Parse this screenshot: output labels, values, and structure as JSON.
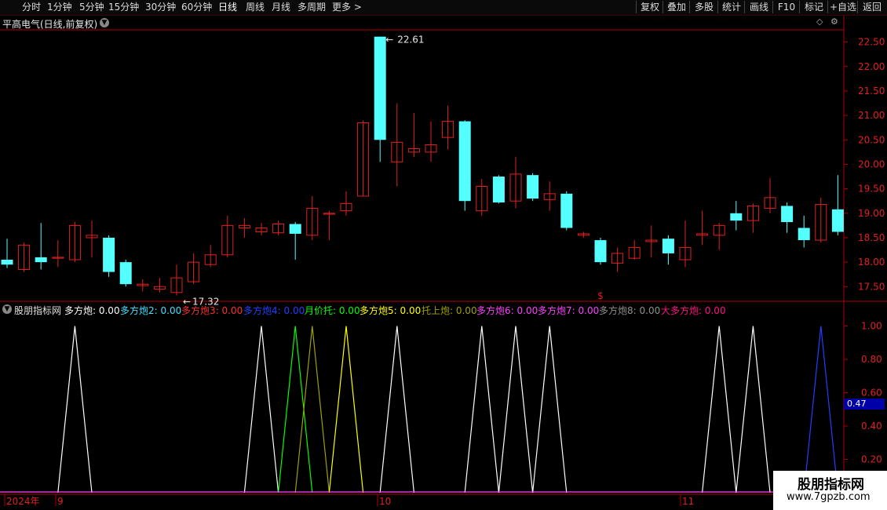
{
  "toolbar": {
    "tabs": [
      "分时",
      "1分钟",
      "5分钟",
      "15分钟",
      "30分钟",
      "60分钟",
      "日线",
      "周线",
      "月线",
      "多周期",
      "更多"
    ],
    "active_tab": "日线",
    "more_arrow": ">",
    "right_buttons": [
      "复权",
      "叠加",
      "多股",
      "统计",
      "画线",
      "F10",
      "标记",
      "+自选",
      "返回"
    ]
  },
  "main_chart": {
    "title": "平高电气(日线,前复权)",
    "dropdown_icon": "chevron-down-icon",
    "high_label": "22.61",
    "low_label": "17.32",
    "signal_mark": "$"
  },
  "indicator": {
    "name": "股朋指标网",
    "items": [
      {
        "label": "多方炮:",
        "value": "0.00",
        "color": "#ffffff"
      },
      {
        "label": "多方炮2:",
        "value": "0.00",
        "color": "#40e0ff"
      },
      {
        "label": "多方炮3:",
        "value": "0.00",
        "color": "#ff3030"
      },
      {
        "label": "多方炮4:",
        "value": "0.00",
        "color": "#2040ff"
      },
      {
        "label": "月价托:",
        "value": "0.00",
        "color": "#00ff00"
      },
      {
        "label": "多方炮5:",
        "value": "0.00",
        "color": "#ffff00"
      },
      {
        "label": "托上炮:",
        "value": "0.00",
        "color": "#a0a000"
      },
      {
        "label": "多方炮6:",
        "value": "0.00",
        "color": "#ff40ff"
      },
      {
        "label": "多方炮7:",
        "value": "0.00",
        "color": "#ff40ff"
      },
      {
        "label": "多方炮8:",
        "value": "0.00",
        "color": "#909090"
      },
      {
        "label": "大多方炮:",
        "value": "0.00",
        "color": "#ff1080"
      }
    ],
    "current_value": "0.47"
  },
  "watermark": {
    "line1": "股朋指标网",
    "line2": "www.7gpzb.com"
  },
  "chart_data": [
    {
      "type": "candlestick",
      "title": "平高电气(日线,前复权)",
      "y_ticks": [
        "22.50",
        "22.00",
        "21.50",
        "21.00",
        "20.50",
        "20.00",
        "19.50",
        "19.00",
        "18.50",
        "18.00",
        "17.50"
      ],
      "ylim": [
        17.2,
        22.75
      ],
      "x_labels": [
        "2024年",
        "9",
        "10",
        "11"
      ],
      "candles": [
        {
          "o": 18.05,
          "c": 17.95,
          "h": 18.48,
          "l": 17.88
        },
        {
          "o": 17.85,
          "c": 18.35,
          "h": 18.4,
          "l": 17.8
        },
        {
          "o": 18.1,
          "c": 18.0,
          "h": 18.8,
          "l": 17.85
        },
        {
          "o": 18.08,
          "c": 18.1,
          "h": 18.45,
          "l": 17.9
        },
        {
          "o": 18.05,
          "c": 18.75,
          "h": 18.82,
          "l": 18.0
        },
        {
          "o": 18.5,
          "c": 18.55,
          "h": 18.85,
          "l": 18.1
        },
        {
          "o": 18.5,
          "c": 17.8,
          "h": 18.55,
          "l": 17.7
        },
        {
          "o": 18.0,
          "c": 17.55,
          "h": 18.05,
          "l": 17.5
        },
        {
          "o": 17.52,
          "c": 17.55,
          "h": 17.65,
          "l": 17.4
        },
        {
          "o": 17.45,
          "c": 17.5,
          "h": 17.68,
          "l": 17.38
        },
        {
          "o": 17.38,
          "c": 17.68,
          "h": 17.95,
          "l": 17.32
        },
        {
          "o": 17.6,
          "c": 18.0,
          "h": 18.18,
          "l": 17.55
        },
        {
          "o": 17.95,
          "c": 18.15,
          "h": 18.35,
          "l": 17.9
        },
        {
          "o": 18.15,
          "c": 18.75,
          "h": 18.95,
          "l": 18.1
        },
        {
          "o": 18.7,
          "c": 18.75,
          "h": 18.9,
          "l": 18.5
        },
        {
          "o": 18.62,
          "c": 18.7,
          "h": 18.8,
          "l": 18.55
        },
        {
          "o": 18.6,
          "c": 18.78,
          "h": 18.85,
          "l": 18.55
        },
        {
          "o": 18.78,
          "c": 18.58,
          "h": 18.82,
          "l": 18.05
        },
        {
          "o": 18.55,
          "c": 19.1,
          "h": 19.35,
          "l": 18.45
        },
        {
          "o": 18.98,
          "c": 19.0,
          "h": 19.05,
          "l": 18.45
        },
        {
          "o": 19.05,
          "c": 19.2,
          "h": 19.45,
          "l": 18.95
        },
        {
          "o": 19.35,
          "c": 20.85,
          "h": 20.9,
          "l": 19.35
        },
        {
          "o": 22.61,
          "c": 20.5,
          "h": 22.61,
          "l": 20.05
        },
        {
          "o": 20.05,
          "c": 20.45,
          "h": 21.25,
          "l": 19.55
        },
        {
          "o": 20.25,
          "c": 20.32,
          "h": 21.05,
          "l": 20.15
        },
        {
          "o": 20.25,
          "c": 20.4,
          "h": 20.88,
          "l": 20.05
        },
        {
          "o": 20.55,
          "c": 20.88,
          "h": 21.2,
          "l": 20.3
        },
        {
          "o": 20.88,
          "c": 19.25,
          "h": 20.9,
          "l": 19.05
        },
        {
          "o": 19.05,
          "c": 19.55,
          "h": 19.7,
          "l": 18.95
        },
        {
          "o": 19.75,
          "c": 19.22,
          "h": 19.78,
          "l": 19.2
        },
        {
          "o": 19.25,
          "c": 19.8,
          "h": 20.15,
          "l": 19.1
        },
        {
          "o": 19.78,
          "c": 19.3,
          "h": 19.82,
          "l": 19.25
        },
        {
          "o": 19.28,
          "c": 19.4,
          "h": 19.65,
          "l": 19.05
        },
        {
          "o": 19.4,
          "c": 18.7,
          "h": 19.45,
          "l": 18.65
        },
        {
          "o": 18.55,
          "c": 18.58,
          "h": 18.62,
          "l": 18.5
        },
        {
          "o": 18.45,
          "c": 18.0,
          "h": 18.5,
          "l": 17.95
        },
        {
          "o": 17.98,
          "c": 18.18,
          "h": 18.3,
          "l": 17.8
        },
        {
          "o": 18.08,
          "c": 18.3,
          "h": 18.45,
          "l": 18.05
        },
        {
          "o": 18.42,
          "c": 18.45,
          "h": 18.75,
          "l": 18.1
        },
        {
          "o": 18.48,
          "c": 18.18,
          "h": 18.55,
          "l": 17.95
        },
        {
          "o": 18.05,
          "c": 18.3,
          "h": 18.85,
          "l": 17.9
        },
        {
          "o": 18.55,
          "c": 18.58,
          "h": 19.05,
          "l": 18.35
        },
        {
          "o": 18.55,
          "c": 18.75,
          "h": 18.8,
          "l": 18.25
        },
        {
          "o": 19.0,
          "c": 18.85,
          "h": 19.25,
          "l": 18.65
        },
        {
          "o": 18.85,
          "c": 19.15,
          "h": 19.2,
          "l": 18.6
        },
        {
          "o": 19.1,
          "c": 19.32,
          "h": 19.72,
          "l": 19.0
        },
        {
          "o": 19.15,
          "c": 18.82,
          "h": 19.22,
          "l": 18.6
        },
        {
          "o": 18.7,
          "c": 18.45,
          "h": 18.95,
          "l": 18.3
        },
        {
          "o": 18.45,
          "c": 19.18,
          "h": 19.32,
          "l": 18.4
        },
        {
          "o": 19.08,
          "c": 18.62,
          "h": 19.78,
          "l": 18.55
        }
      ]
    },
    {
      "type": "line",
      "title": "股朋指标网",
      "y_ticks": [
        "1.00",
        "0.80",
        "0.60",
        "0.40",
        "0.20"
      ],
      "ylim": [
        0,
        1.05
      ],
      "x": [
        0,
        1,
        2,
        3,
        4,
        5,
        6,
        7,
        8,
        9,
        10,
        11,
        12,
        13,
        14,
        15,
        16,
        17,
        18,
        19,
        20,
        21,
        22,
        23,
        24,
        25,
        26,
        27,
        28,
        29,
        30,
        31,
        32,
        33,
        34,
        35,
        36,
        37,
        38,
        39,
        40,
        41,
        42,
        43,
        44,
        45,
        46,
        47,
        48,
        49
      ],
      "series": [
        {
          "name": "多方炮",
          "color": "#ffffff",
          "spikes": [
            4,
            15,
            23,
            28,
            30,
            32,
            42,
            44
          ]
        },
        {
          "name": "月价托",
          "color": "#00ff00",
          "spikes": [
            17
          ]
        },
        {
          "name": "托上炮",
          "color": "#a0a000",
          "spikes": [
            18
          ]
        },
        {
          "name": "多方炮5",
          "color": "#ffff00",
          "spikes": [
            20
          ]
        },
        {
          "name": "多方炮4",
          "color": "#2040ff",
          "spikes": [
            48
          ]
        }
      ]
    }
  ]
}
